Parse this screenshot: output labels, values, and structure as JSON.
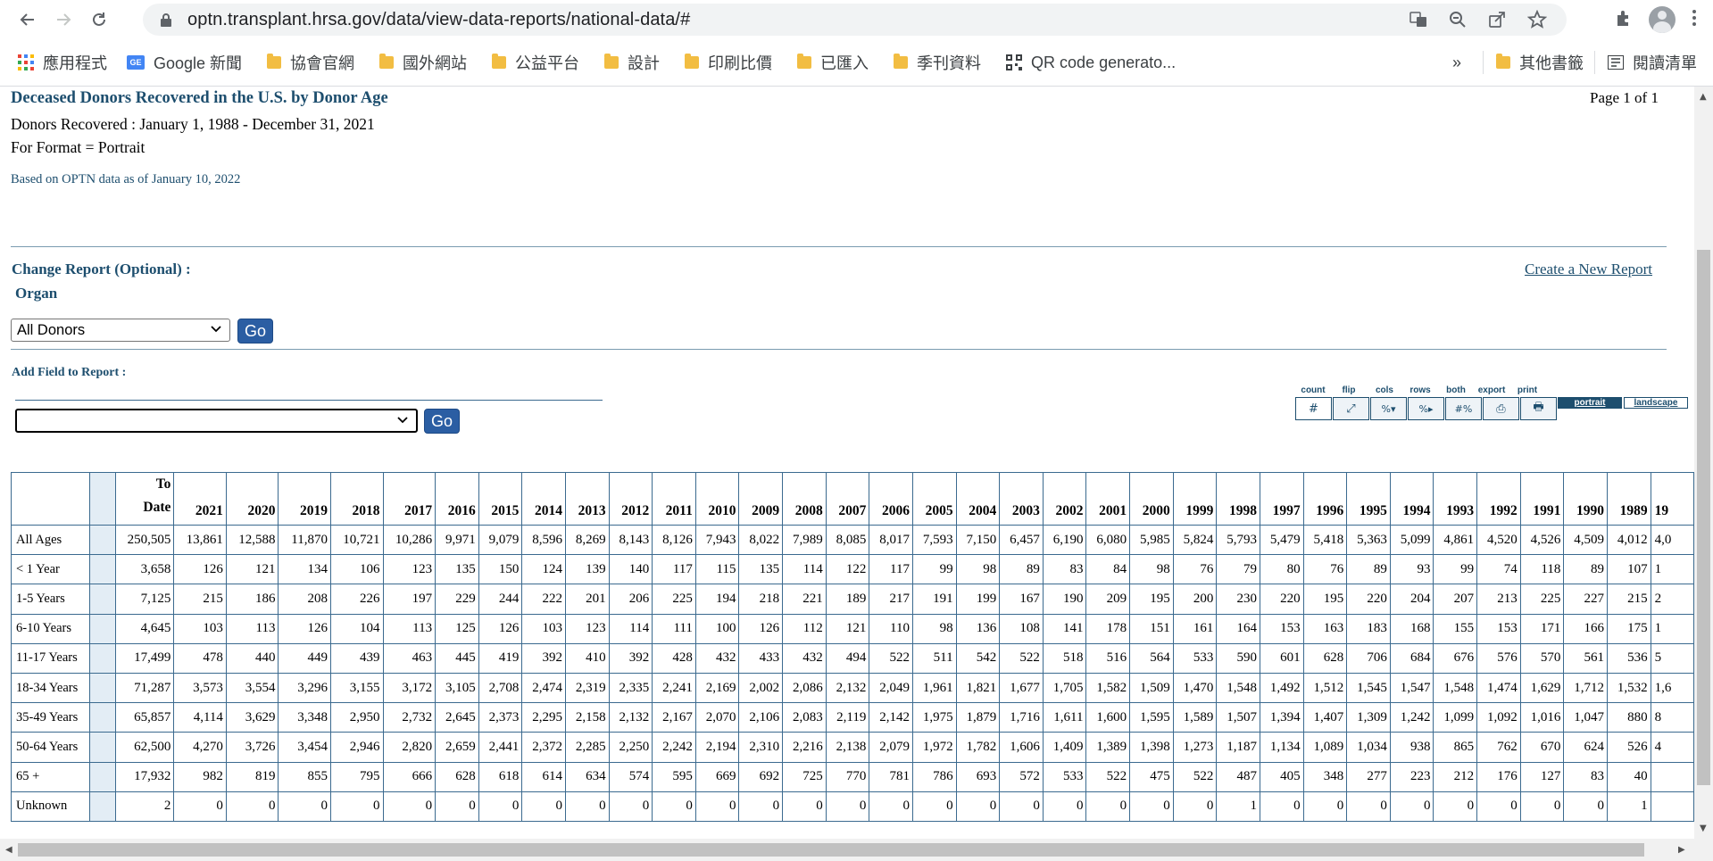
{
  "browser": {
    "url": "optn.transplant.hrsa.gov/data/view-data-reports/national-data/#",
    "bookmarks": [
      {
        "label": "應用程式",
        "icon": "apps-grid-icon"
      },
      {
        "label": "Google 新聞",
        "icon": "google-news-icon"
      },
      {
        "label": "協會官網",
        "icon": "folder-icon"
      },
      {
        "label": "國外網站",
        "icon": "folder-icon"
      },
      {
        "label": "公益平台",
        "icon": "folder-icon"
      },
      {
        "label": "設計",
        "icon": "folder-icon"
      },
      {
        "label": "印刷比價",
        "icon": "folder-icon"
      },
      {
        "label": "已匯入",
        "icon": "folder-icon"
      },
      {
        "label": "季刊資料",
        "icon": "folder-icon"
      },
      {
        "label": "QR code generato...",
        "icon": "qr-code-icon"
      }
    ],
    "overflow": "»",
    "other_bookmarks": "其他書籤",
    "reading_list": "閱讀清單"
  },
  "report": {
    "title": "Deceased Donors Recovered in the U.S. by Donor Age",
    "page_of": "Page 1 of 1",
    "subtitle": "Donors Recovered : January 1, 1988 - December 31, 2021",
    "format": "For Format = Portrait",
    "based_on": "Based on OPTN data as of January 10, 2022",
    "change_report": "Change Report (Optional) :",
    "organ_label": "Organ",
    "create_new": "Create a New Report",
    "organ_selected": "All Donors",
    "go_label": "Go",
    "add_field": "Add Field to Report :"
  },
  "tools": {
    "labels": [
      "count",
      "flip",
      "cols",
      "rows",
      "both",
      "export",
      "print"
    ],
    "glyphs": [
      "#",
      "⤢",
      "%▾",
      "%▸",
      "#%",
      "⎙",
      "🖶"
    ],
    "portrait": "portrait",
    "landscape": "landscape"
  },
  "table": {
    "columns": [
      "To Date",
      "2021",
      "2020",
      "2019",
      "2018",
      "2017",
      "2016",
      "2015",
      "2014",
      "2013",
      "2012",
      "2011",
      "2010",
      "2009",
      "2008",
      "2007",
      "2006",
      "2005",
      "2004",
      "2003",
      "2002",
      "2001",
      "2000",
      "1999",
      "1998",
      "1997",
      "1996",
      "1995",
      "1994",
      "1993",
      "1992",
      "1991",
      "1990",
      "1989",
      "19"
    ],
    "rows": [
      {
        "label": "All Ages",
        "values": [
          "250,505",
          "13,861",
          "12,588",
          "11,870",
          "10,721",
          "10,286",
          "9,971",
          "9,079",
          "8,596",
          "8,269",
          "8,143",
          "8,126",
          "7,943",
          "8,022",
          "7,989",
          "8,085",
          "8,017",
          "7,593",
          "7,150",
          "6,457",
          "6,190",
          "6,080",
          "5,985",
          "5,824",
          "5,793",
          "5,479",
          "5,418",
          "5,363",
          "5,099",
          "4,861",
          "4,520",
          "4,526",
          "4,509",
          "4,012",
          "4,0"
        ]
      },
      {
        "label": "< 1 Year",
        "values": [
          "3,658",
          "126",
          "121",
          "134",
          "106",
          "123",
          "135",
          "150",
          "124",
          "139",
          "140",
          "117",
          "115",
          "135",
          "114",
          "122",
          "117",
          "99",
          "98",
          "89",
          "83",
          "84",
          "98",
          "76",
          "79",
          "80",
          "76",
          "89",
          "93",
          "99",
          "74",
          "118",
          "89",
          "107",
          "1"
        ]
      },
      {
        "label": "1-5 Years",
        "values": [
          "7,125",
          "215",
          "186",
          "208",
          "226",
          "197",
          "229",
          "244",
          "222",
          "201",
          "206",
          "225",
          "194",
          "218",
          "221",
          "189",
          "217",
          "191",
          "199",
          "167",
          "190",
          "209",
          "195",
          "200",
          "230",
          "220",
          "195",
          "220",
          "204",
          "207",
          "213",
          "225",
          "227",
          "215",
          "2"
        ]
      },
      {
        "label": "6-10 Years",
        "values": [
          "4,645",
          "103",
          "113",
          "126",
          "104",
          "113",
          "125",
          "126",
          "103",
          "123",
          "114",
          "111",
          "100",
          "126",
          "112",
          "121",
          "110",
          "98",
          "136",
          "108",
          "141",
          "178",
          "151",
          "161",
          "164",
          "153",
          "163",
          "183",
          "168",
          "155",
          "153",
          "171",
          "166",
          "175",
          "1"
        ]
      },
      {
        "label": "11-17 Years",
        "values": [
          "17,499",
          "478",
          "440",
          "449",
          "439",
          "463",
          "445",
          "419",
          "392",
          "410",
          "392",
          "428",
          "432",
          "433",
          "432",
          "494",
          "522",
          "511",
          "542",
          "522",
          "518",
          "516",
          "564",
          "533",
          "590",
          "601",
          "628",
          "706",
          "684",
          "676",
          "576",
          "570",
          "561",
          "536",
          "5"
        ]
      },
      {
        "label": "18-34 Years",
        "values": [
          "71,287",
          "3,573",
          "3,554",
          "3,296",
          "3,155",
          "3,172",
          "3,105",
          "2,708",
          "2,474",
          "2,319",
          "2,335",
          "2,241",
          "2,169",
          "2,002",
          "2,086",
          "2,132",
          "2,049",
          "1,961",
          "1,821",
          "1,677",
          "1,705",
          "1,582",
          "1,509",
          "1,470",
          "1,548",
          "1,492",
          "1,512",
          "1,545",
          "1,547",
          "1,548",
          "1,474",
          "1,629",
          "1,712",
          "1,532",
          "1,6"
        ]
      },
      {
        "label": "35-49 Years",
        "values": [
          "65,857",
          "4,114",
          "3,629",
          "3,348",
          "2,950",
          "2,732",
          "2,645",
          "2,373",
          "2,295",
          "2,158",
          "2,132",
          "2,167",
          "2,070",
          "2,106",
          "2,083",
          "2,119",
          "2,142",
          "1,975",
          "1,879",
          "1,716",
          "1,611",
          "1,600",
          "1,595",
          "1,589",
          "1,507",
          "1,394",
          "1,407",
          "1,309",
          "1,242",
          "1,099",
          "1,092",
          "1,016",
          "1,047",
          "880",
          "8"
        ]
      },
      {
        "label": "50-64 Years",
        "values": [
          "62,500",
          "4,270",
          "3,726",
          "3,454",
          "2,946",
          "2,820",
          "2,659",
          "2,441",
          "2,372",
          "2,285",
          "2,250",
          "2,242",
          "2,194",
          "2,310",
          "2,216",
          "2,138",
          "2,079",
          "1,972",
          "1,782",
          "1,606",
          "1,409",
          "1,389",
          "1,398",
          "1,273",
          "1,187",
          "1,134",
          "1,089",
          "1,034",
          "938",
          "865",
          "762",
          "670",
          "624",
          "526",
          "4"
        ]
      },
      {
        "label": "65 +",
        "values": [
          "17,932",
          "982",
          "819",
          "855",
          "795",
          "666",
          "628",
          "618",
          "614",
          "634",
          "574",
          "595",
          "669",
          "692",
          "725",
          "770",
          "781",
          "786",
          "693",
          "572",
          "533",
          "522",
          "475",
          "522",
          "487",
          "405",
          "348",
          "277",
          "223",
          "212",
          "176",
          "127",
          "83",
          "40",
          ""
        ]
      },
      {
        "label": "Unknown",
        "values": [
          "2",
          "0",
          "0",
          "0",
          "0",
          "0",
          "0",
          "0",
          "0",
          "0",
          "0",
          "0",
          "0",
          "0",
          "0",
          "0",
          "0",
          "0",
          "0",
          "0",
          "0",
          "0",
          "0",
          "0",
          "1",
          "0",
          "0",
          "0",
          "0",
          "0",
          "0",
          "0",
          "0",
          "1",
          ""
        ]
      }
    ]
  }
}
